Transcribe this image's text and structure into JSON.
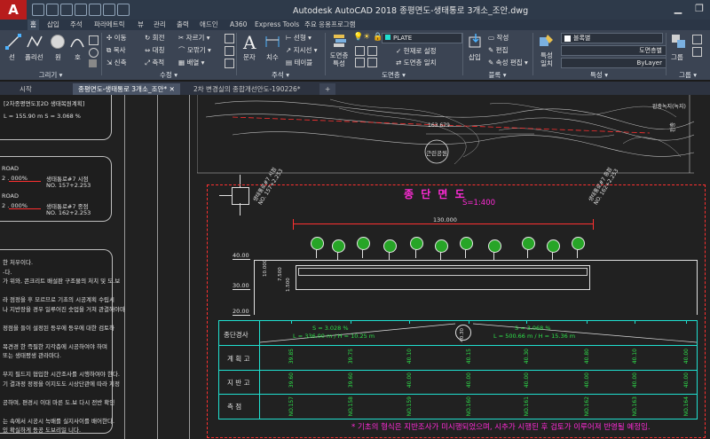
{
  "app": {
    "logo": "A",
    "title": "Autodesk AutoCAD 2018    종평면도-생태통로 3개소_조안.dwg",
    "window_controls": [
      "▁",
      "❐",
      "✕"
    ]
  },
  "menu_tabs": [
    "홈",
    "삽입",
    "주석",
    "파라메트릭",
    "뷰",
    "관리",
    "출력",
    "애드인",
    "A360",
    "Express Tools",
    "주요 응용프로그램"
  ],
  "ribbon": {
    "draw": {
      "line": "선",
      "polyline": "폴리선",
      "circle": "원",
      "arc": "호",
      "footer": "그리기 ▾"
    },
    "modify": {
      "move": "이동",
      "copy": "복사",
      "stretch": "신축",
      "rotate": "회전",
      "mirror": "대칭",
      "scale": "축적",
      "trim": "자르기 ▾",
      "fillet": "모깎기 ▾",
      "array": "배열 ▾",
      "footer": "수정 ▾"
    },
    "annotation": {
      "text": "문자",
      "dimension": "치수",
      "linear": "선형 ▾",
      "leader": "지시선 ▾",
      "table": "테이블",
      "footer": "주석 ▾"
    },
    "layers": {
      "layer_props": "도면층 특성",
      "current": "PLATE",
      "make_current": "현재로 설정",
      "match": "도면층 일치",
      "footer": "도면층 ▾"
    },
    "block": {
      "insert": "삽입",
      "create": "작성",
      "edit": "편집",
      "attr_edit": "속성 편집 ▾",
      "footer": "블록 ▾"
    },
    "properties": {
      "match": "특성 일치",
      "color": "블록별",
      "linetype": "도면층별",
      "lineweight": "ByLayer",
      "footer": "특성 ▾"
    },
    "groups": {
      "group": "그룹",
      "footer": "그룹 ▾"
    }
  },
  "file_tabs": [
    {
      "label": "시작",
      "active": false
    },
    {
      "label": "종평면도-생태통로 3개소_조안*",
      "active": true
    },
    {
      "label": "2차 변경실의 종합개선안도-190226*",
      "active": false
    }
  ],
  "new_tab": "+",
  "drawing": {
    "left_panels": {
      "p1": [
        "[2차종평면도][2D 생태복원계획]",
        "L = 155.90 m   S = 3.068 %"
      ],
      "p2": [
        "ROAD",
        "2 . 000%",
        "ROAD",
        "2 . 000%"
      ],
      "p2_labels": [
        "생태통로#7 시점",
        "NO. 157+2.253",
        "생태통로#7 종점",
        "NO. 162+2.253"
      ],
      "p3": [
        "한 처우이다.",
        "-다.",
        "가 위와, 콘크리트 배설판 구조물의 처치 및 도.보",
        "",
        "라 점정을 후 모르므로 기초의 시공계획 수립시",
        "나 지반장을 경우 일루어진 숫업을 거쳐 관결해야마",
        "",
        "정점을 들이 설정된 등우에 등우에 대한 검토하",
        "",
        "목견경 한 즉필한 지각층에 시공하여야 하며",
        "또는 생태평생 관라마다.",
        "",
        "부지 필드지 협입한 시간조사를 시행하여야 한다.",
        "기 결과정 정정을 이지도도 시상단관에 따라 지정",
        "",
        "공하며, 편경시 이대 마른 도.보 다시 전반 확인",
        "",
        "는 속에서 시공시 녹배를 실지사이를 배어한다.",
        "있 확실하게 등공 도보리일 니다."
      ]
    },
    "map": {
      "dimension": "163.679",
      "park": "근린공원",
      "green": "완충녹지(녹지)",
      "side": "완충"
    },
    "profile": {
      "title": "종 단 면 도",
      "scale": "S=1:400",
      "start_label": [
        "생태통로#7 시점",
        "NO. 157+2.253"
      ],
      "end_label": [
        "생태통로#7 종점",
        "NO. 162+2.253"
      ],
      "span": "130.000",
      "elev_ticks": [
        "40.00",
        "30.00",
        "20.00"
      ],
      "dims": [
        "10.000",
        "7.500",
        "1.500",
        "2.000"
      ],
      "table_rows": [
        "종단경사",
        "계 획 고",
        "지 반 고",
        "측    점"
      ],
      "grade1": "S = 3.028 %",
      "grade1b": "L = 336.00 m / H = 10.25 m",
      "grade2": "S = 3.068 %",
      "grade2b": "L = 500.66 m / H = 15.36 m",
      "pvi": "40.30",
      "plan_elev": [
        "39.85",
        "39.75",
        "40.10",
        "40.15",
        "40.30",
        "40.80",
        "40.10",
        "40.00"
      ],
      "ground_elev": [
        "39.60",
        "39.60",
        "40.00",
        "40.00",
        "40.00",
        "40.00",
        "40.00",
        "40.00"
      ],
      "stations": [
        "NO.157",
        "NO.158",
        "NO.159",
        "NO.160",
        "NO.161",
        "NO.162",
        "NO.163",
        "NO.164"
      ],
      "note": "* 기초의 형식은 지반조사가 미시행되었으며, 시추가 시행된 후 검토가 이루어져 반영될 예정임."
    }
  },
  "colors": {
    "ribbon_bg": "#3b4453",
    "title_bg": "#2e3a4a",
    "magenta": "#ff2bd6",
    "red": "#ff3030",
    "green": "#2ee04a",
    "cyan": "#20e0d0"
  }
}
